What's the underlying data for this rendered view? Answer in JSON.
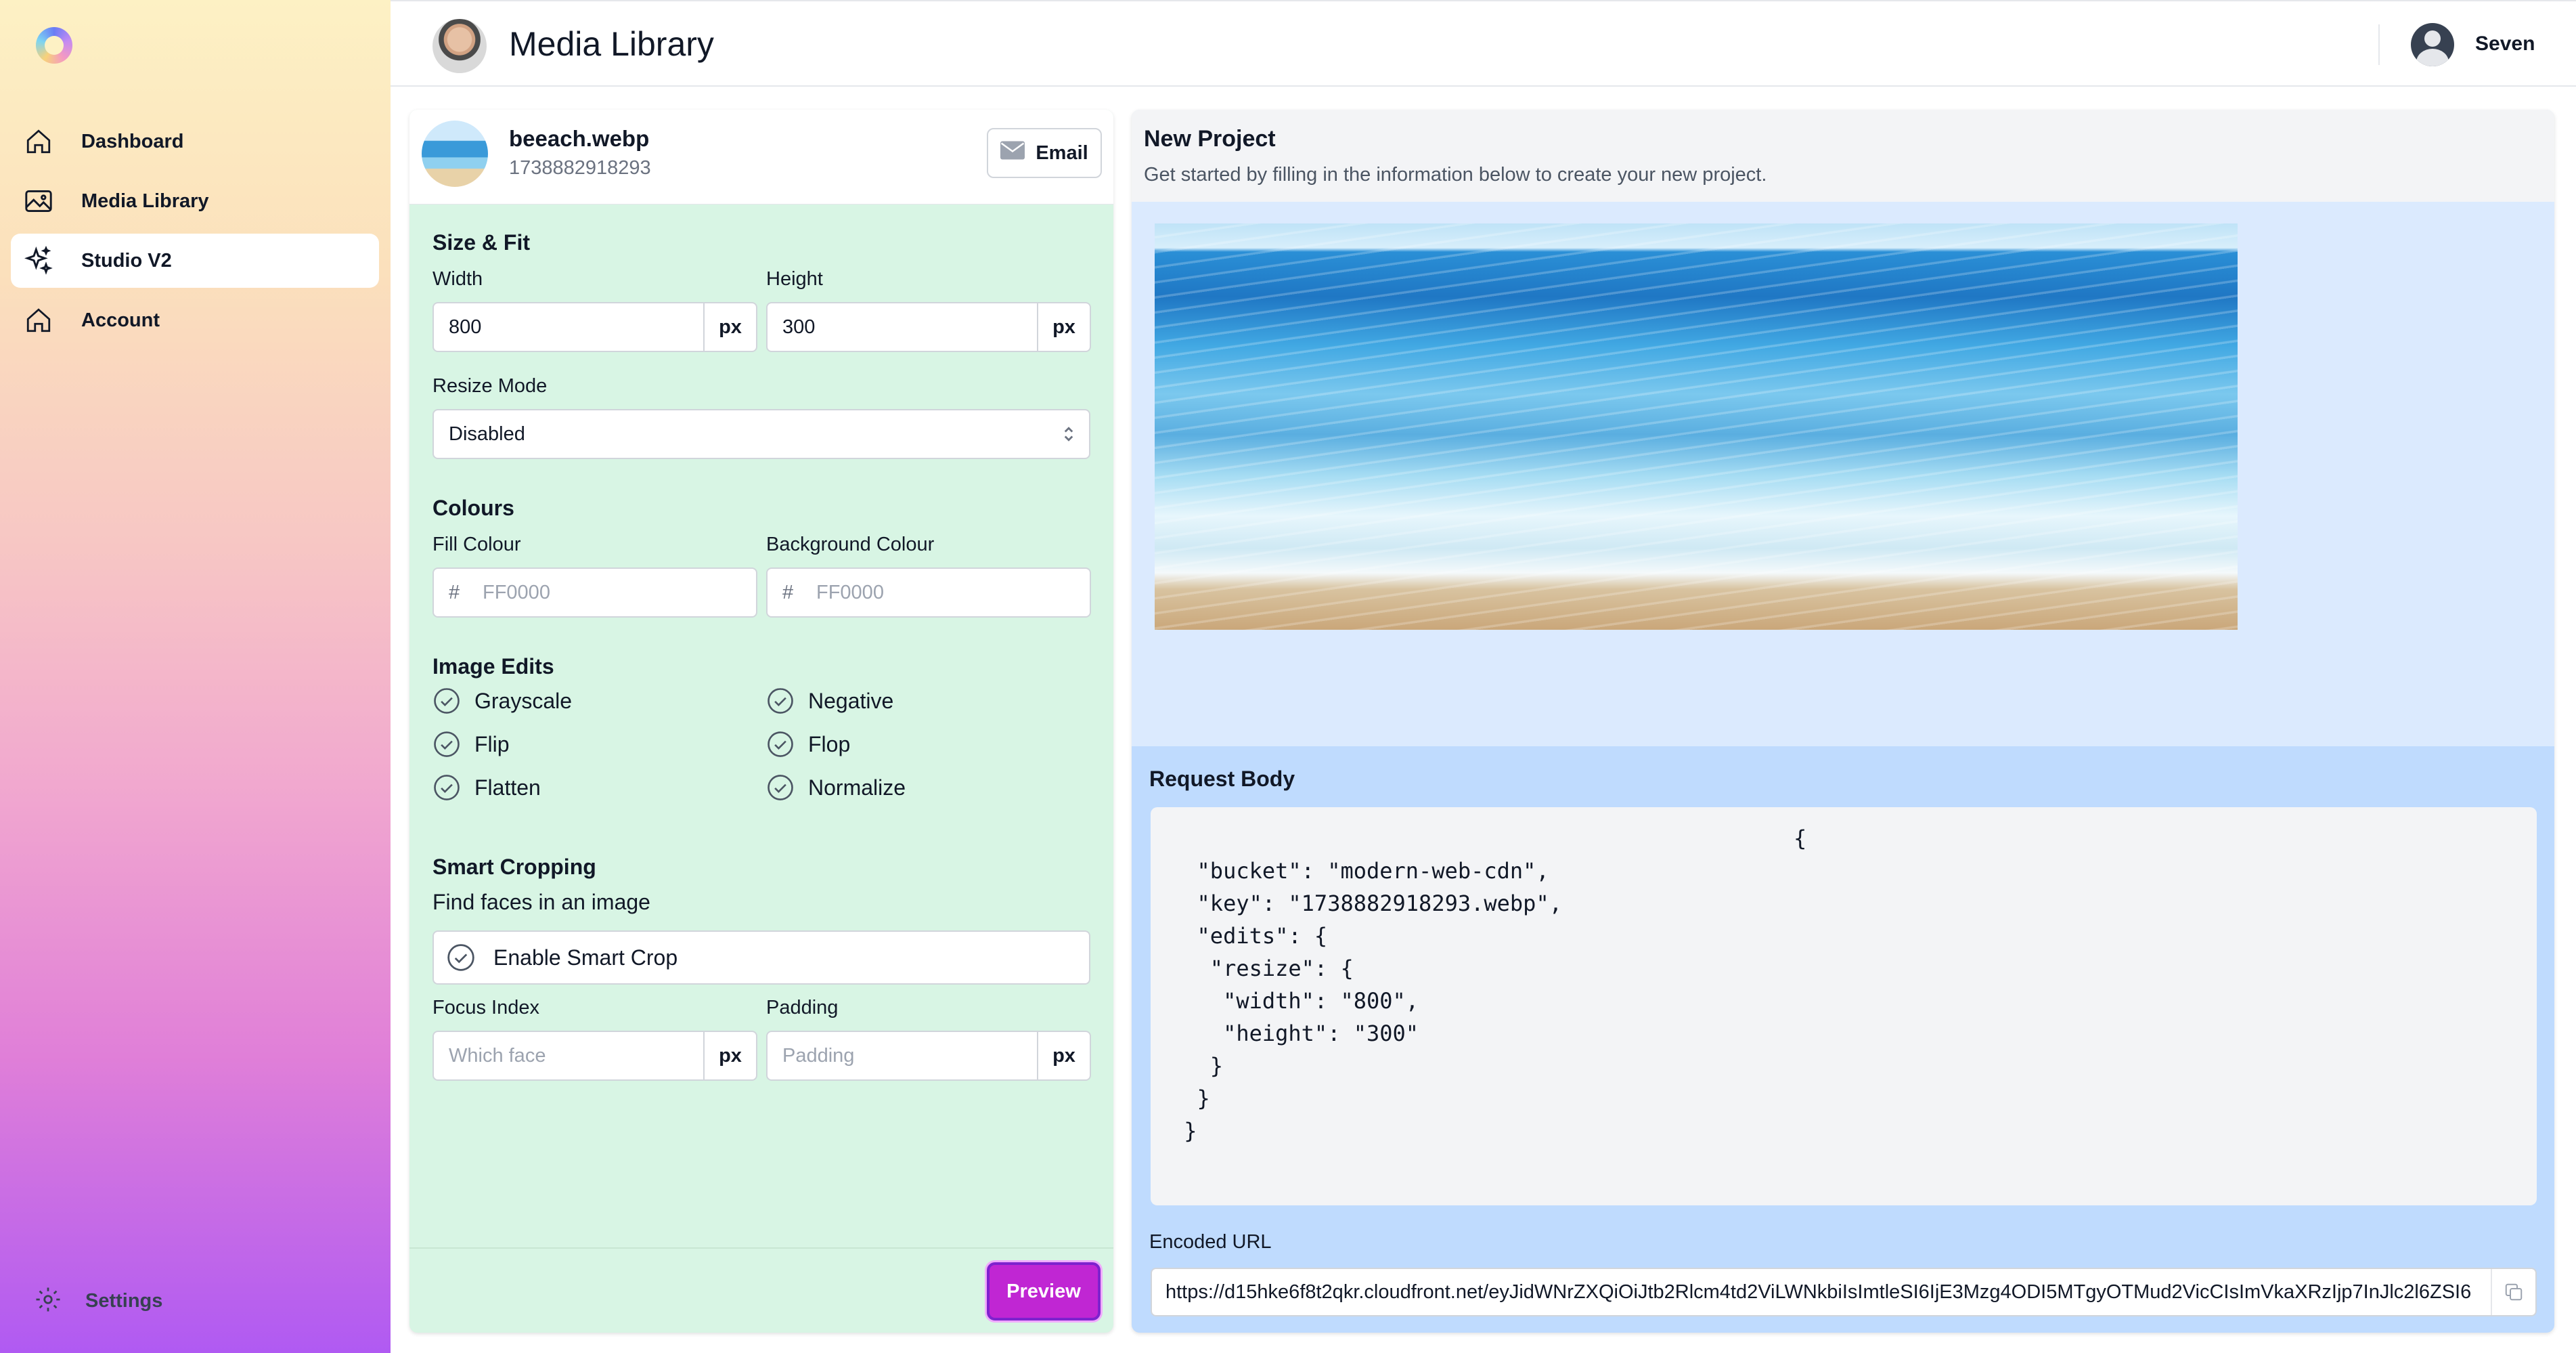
{
  "sidebar": {
    "items": [
      {
        "label": "Dashboard",
        "icon": "home-icon"
      },
      {
        "label": "Media Library",
        "icon": "image-icon"
      },
      {
        "label": "Studio V2",
        "icon": "sparkles-icon",
        "active": true
      },
      {
        "label": "Account",
        "icon": "home-icon"
      }
    ],
    "settings_label": "Settings"
  },
  "header": {
    "title": "Media Library",
    "user_name": "Seven"
  },
  "editor": {
    "file_name": "beeach.webp",
    "file_id": "1738882918293",
    "email_label": "Email",
    "size_fit": {
      "title": "Size & Fit",
      "width_label": "Width",
      "width_value": "800",
      "height_label": "Height",
      "height_value": "300",
      "unit": "px",
      "resize_mode_label": "Resize Mode",
      "resize_mode_value": "Disabled"
    },
    "colours": {
      "title": "Colours",
      "fill_label": "Fill Colour",
      "fill_placeholder": "FF0000",
      "bg_label": "Background Colour",
      "bg_placeholder": "FF0000",
      "hash": "#"
    },
    "image_edits": {
      "title": "Image Edits",
      "options": [
        "Grayscale",
        "Negative",
        "Flip",
        "Flop",
        "Flatten",
        "Normalize"
      ]
    },
    "smart_cropping": {
      "title": "Smart Cropping",
      "subtitle": "Find faces in an image",
      "toggle_label": "Enable Smart Crop",
      "focus_label": "Focus Index",
      "focus_placeholder": "Which face",
      "padding_label": "Padding",
      "padding_placeholder": "Padding",
      "unit": "px"
    },
    "preview_label": "Preview"
  },
  "project": {
    "title": "New Project",
    "subtitle": "Get started by filling in the information below to create your new project."
  },
  "request": {
    "title": "Request Body",
    "code_open": "{",
    "code_body": "\"bucket\": \"modern-web-cdn\",\n\"key\": \"1738882918293.webp\",\n\"edits\": {\n  \"resize\": {\n    \"width\": \"800\",\n    \"height\": \"300\"\n  }\n}\n}",
    "url_label": "Encoded URL",
    "url_value": "https://d15hke6f8t2qkr.cloudfront.net/eyJidWNrZXQiOiJtb2Rlcm4td2ViLWNkbiIsImtleSI6IjE3Mzg4ODI5MTgyOTMud2VicCIsImVkaXRzIjp7InJlc2l6ZSI6"
  },
  "colors": {
    "accent": "#c026d3",
    "editor_bg": "#d8f5e4",
    "right_bg": "#dbeafe"
  }
}
